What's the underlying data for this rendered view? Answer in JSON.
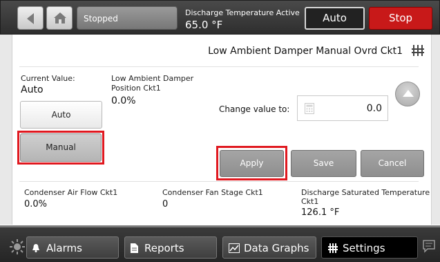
{
  "header": {
    "status": "Stopped",
    "discharge_label": "Discharge Temperature Active",
    "discharge_value": "65.0 °F",
    "auto_label": "Auto",
    "stop_label": "Stop"
  },
  "page": {
    "title": "Low Ambient Damper Manual Ovrd Ckt1"
  },
  "control": {
    "current_value_label": "Current Value:",
    "current_value": "Auto",
    "position_label_line1": "Low Ambient Damper",
    "position_label_line2": "Position Ckt1",
    "position_value": "0.0%",
    "option_auto": "Auto",
    "option_manual": "Manual",
    "change_label": "Change value to:",
    "input_value": "0.0",
    "apply_label": "Apply",
    "save_label": "Save",
    "cancel_label": "Cancel"
  },
  "readouts": [
    {
      "label": "Condenser Air Flow Ckt1",
      "value": "0.0%"
    },
    {
      "label": "Condenser Fan Stage Ckt1",
      "value": "0"
    },
    {
      "label_line1": "Discharge Saturated Temperature",
      "label_line2": "Ckt1",
      "value": "126.1 °F"
    }
  ],
  "nav": {
    "alarms": "Alarms",
    "reports": "Reports",
    "data_graphs": "Data Graphs",
    "settings": "Settings"
  },
  "colors": {
    "stop": "#c81919",
    "highlight": "#e0181f"
  },
  "icons": [
    "back-icon",
    "home-icon",
    "grid-icon",
    "calculator-icon",
    "up-arrow-icon",
    "brightness-icon",
    "bell-icon",
    "document-icon",
    "chart-icon",
    "settings-icon",
    "chat-icon"
  ]
}
